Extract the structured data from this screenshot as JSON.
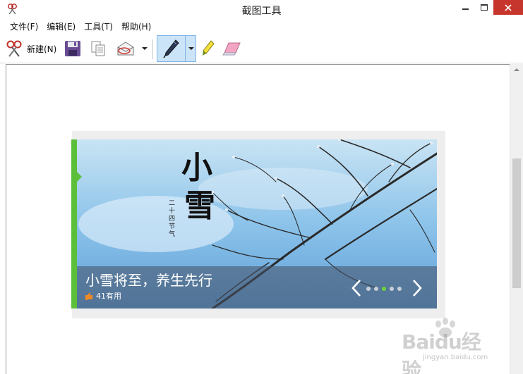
{
  "window": {
    "title": "截图工具"
  },
  "menu": {
    "items": [
      "文件(F)",
      "编辑(E)",
      "工具(T)",
      "帮助(H)"
    ]
  },
  "toolbar": {
    "new_label": "新建(N)",
    "icons": [
      "scissors-icon",
      "save-icon",
      "copy-icon",
      "send-email-icon",
      "pen-icon",
      "highlighter-icon",
      "eraser-icon"
    ]
  },
  "capture": {
    "calligraphy_large_1": "小",
    "calligraphy_large_2": "雪",
    "calligraphy_small": "二十四节气",
    "caption_title": "小雪将至，养生先行",
    "likes": "41有用",
    "slide_count": 5,
    "active_slide": 3
  },
  "watermark": {
    "brand": "Baidu经验",
    "url": "jingyan.baidu.com"
  },
  "colors": {
    "close_button": "#c7362c",
    "pen_selected": "#cce4f7",
    "green_accent": "#5bbf3a",
    "active_dot": "#6dd43a"
  }
}
